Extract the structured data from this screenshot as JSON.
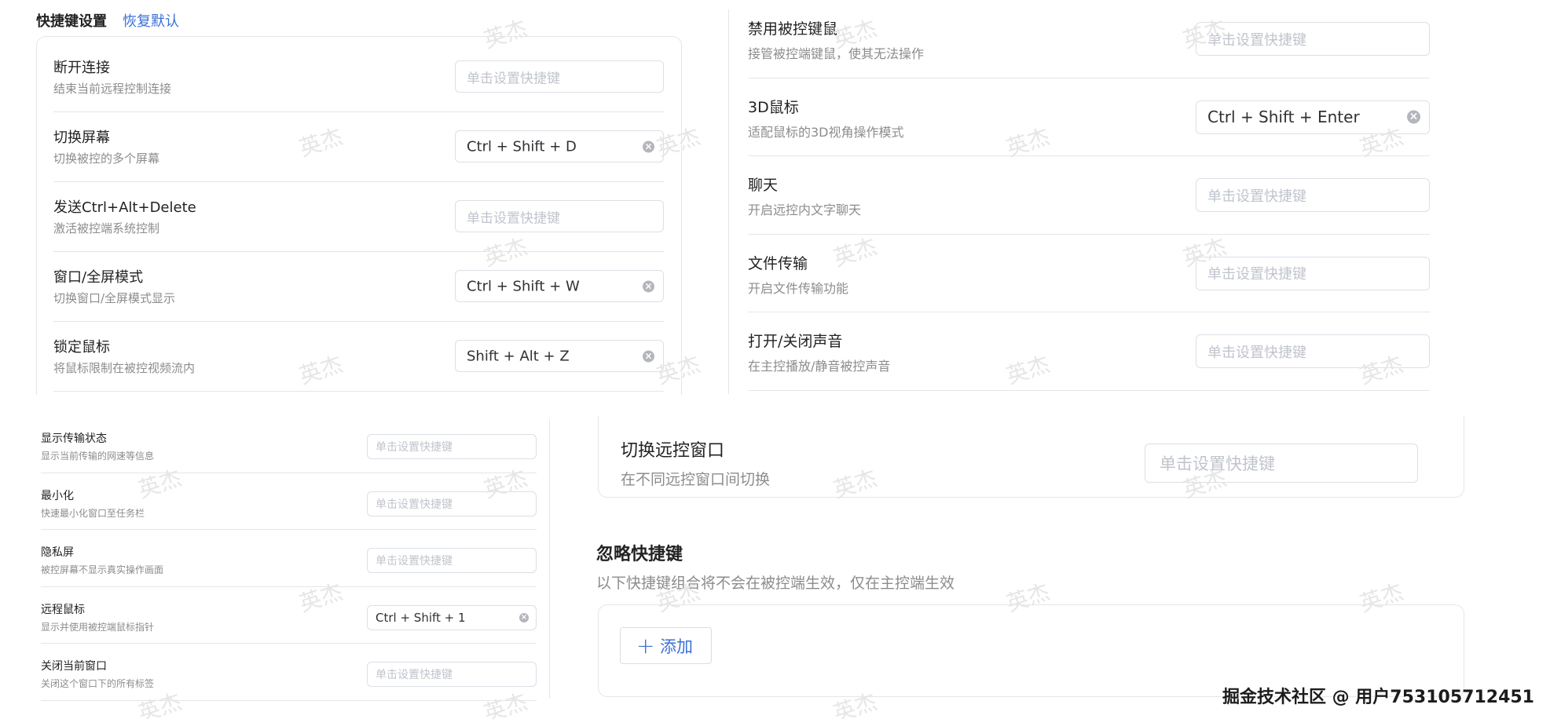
{
  "header": {
    "title": "快捷键设置",
    "reset_link": "恢复默认"
  },
  "placeholder": "单击设置快捷键",
  "panel_a": {
    "rows": [
      {
        "title": "断开连接",
        "desc": "结束当前远程控制连接",
        "value": ""
      },
      {
        "title": "切换屏幕",
        "desc": "切换被控的多个屏幕",
        "value": "Ctrl + Shift + D"
      },
      {
        "title": "发送Ctrl+Alt+Delete",
        "desc": "激活被控端系统控制",
        "value": ""
      },
      {
        "title": "窗口/全屏模式",
        "desc": "切换窗口/全屏模式显示",
        "value": "Ctrl + Shift + W"
      },
      {
        "title": "锁定鼠标",
        "desc": "将鼠标限制在被控视频流内",
        "value": "Shift + Alt + Z"
      }
    ]
  },
  "panel_b": {
    "rows": [
      {
        "title": "禁用被控键鼠",
        "desc": "接管被控端键鼠，使其无法操作",
        "value": ""
      },
      {
        "title": "3D鼠标",
        "desc": "适配鼠标的3D视角操作模式",
        "value": "Ctrl + Shift + Enter"
      },
      {
        "title": "聊天",
        "desc": "开启远控内文字聊天",
        "value": ""
      },
      {
        "title": "文件传输",
        "desc": "开启文件传输功能",
        "value": ""
      },
      {
        "title": "打开/关闭声音",
        "desc": "在主控播放/静音被控声音",
        "value": ""
      }
    ]
  },
  "panel_c": {
    "rows": [
      {
        "title": "显示传输状态",
        "desc": "显示当前传输的网速等信息",
        "value": ""
      },
      {
        "title": "最小化",
        "desc": "快速最小化窗口至任务栏",
        "value": ""
      },
      {
        "title": "隐私屏",
        "desc": "被控屏幕不显示真实操作画面",
        "value": ""
      },
      {
        "title": "远程鼠标",
        "desc": "显示并使用被控端鼠标指针",
        "value": "Ctrl + Shift + 1"
      },
      {
        "title": "关闭当前窗口",
        "desc": "关闭这个窗口下的所有标签",
        "value": ""
      }
    ]
  },
  "panel_d": {
    "switch_row": {
      "title": "切换远控窗口",
      "desc": "在不同远控窗口间切换",
      "value": ""
    },
    "ignore": {
      "title": "忽略快捷键",
      "desc": "以下快捷键组合将不会在被控端生效，仅在主控端生效",
      "add_label": "添加",
      "add_icon": "plus-icon"
    }
  },
  "watermark": "英杰",
  "credit": "掘金技术社区 @ 用户753105712451",
  "colors": {
    "link": "#3a6fd8",
    "border": "#dcdfe6",
    "placeholder": "#c0c4cc",
    "desc": "#8c8c8c"
  }
}
